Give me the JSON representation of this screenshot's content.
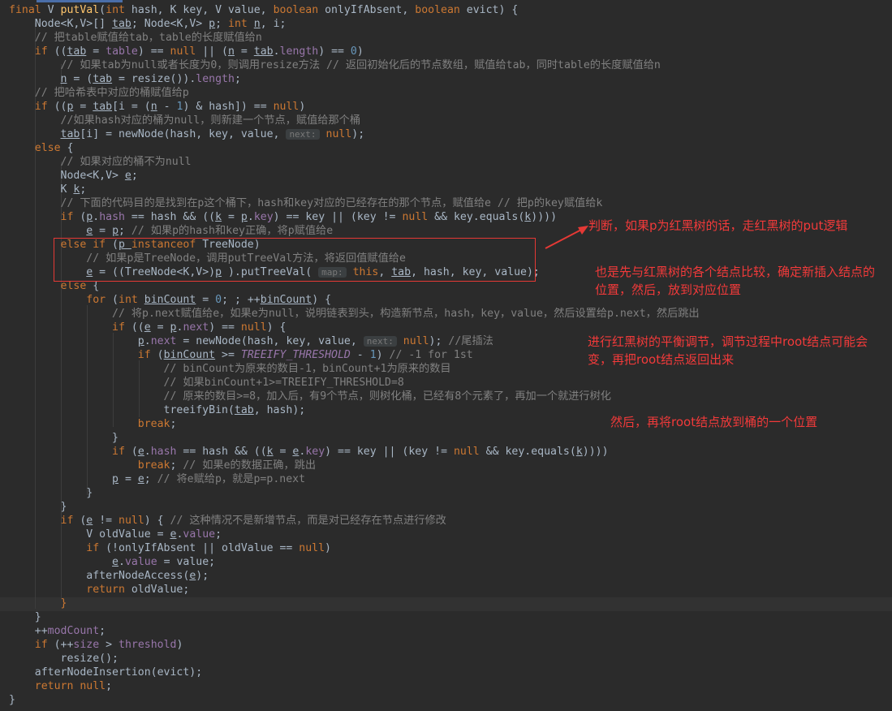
{
  "annotations": {
    "a1": "判断，如果p为红黑树的话，走红黑树的put逻辑",
    "a2": "也是先与红黑树的各个结点比较，确定新插入结点的位置，然后，放到对应位置",
    "a3": "进行红黑树的平衡调节，调节过程中root结点可能会变，再把root结点返回出来",
    "a4": "然后，再将root结点放到桶的一个位置"
  },
  "code": [
    [
      [
        "kw",
        "final "
      ],
      [
        "",
        "V "
      ],
      [
        "m",
        "putVal"
      ],
      [
        "",
        "("
      ],
      [
        "kw",
        "int "
      ],
      [
        "",
        "hash, K key, V value, "
      ],
      [
        "kw",
        "boolean "
      ],
      [
        "",
        "onlyIfAbsent, "
      ],
      [
        "kw",
        "boolean "
      ],
      [
        "",
        "evict) {"
      ]
    ],
    [
      [
        "",
        "    Node<K,V>[] "
      ],
      [
        "ul",
        "tab"
      ],
      [
        "",
        "; Node<K,V> "
      ],
      [
        "ul",
        "p"
      ],
      [
        "",
        "; "
      ],
      [
        "kw",
        "int "
      ],
      [
        "ul",
        "n"
      ],
      [
        "",
        ", i;"
      ]
    ],
    [
      [
        "c",
        "    // 把table赋值给tab，table的长度赋值给n"
      ]
    ],
    [
      [
        "kw",
        "    if "
      ],
      [
        "",
        "(("
      ],
      [
        "ul",
        "tab"
      ],
      [
        "",
        " = "
      ],
      [
        "f",
        "table"
      ],
      [
        "",
        ") == "
      ],
      [
        "kw",
        "null "
      ],
      [
        "",
        "|| ("
      ],
      [
        "ul",
        "n"
      ],
      [
        "",
        " = "
      ],
      [
        "ul",
        "tab"
      ],
      [
        "",
        "."
      ],
      [
        "f",
        "length"
      ],
      [
        "",
        ") == "
      ],
      [
        "num",
        "0"
      ],
      [
        "",
        ")"
      ]
    ],
    [
      [
        "c",
        "        // 如果tab为null或者长度为0，则调用resize方法 // 返回初始化后的节点数组，赋值给tab，同时table的长度赋值给n"
      ]
    ],
    [
      [
        "",
        "        "
      ],
      [
        "ul",
        "n"
      ],
      [
        "",
        " = ("
      ],
      [
        "ul",
        "tab"
      ],
      [
        "",
        " = resize())."
      ],
      [
        "f",
        "length"
      ],
      [
        "",
        ";"
      ]
    ],
    [
      [
        "c",
        "    // 把哈希表中对应的桶赋值给p"
      ]
    ],
    [
      [
        "kw",
        "    if "
      ],
      [
        "",
        "(("
      ],
      [
        "ul",
        "p"
      ],
      [
        "",
        " = "
      ],
      [
        "ul",
        "tab"
      ],
      [
        "",
        "[i = ("
      ],
      [
        "ul",
        "n"
      ],
      [
        "",
        " - "
      ],
      [
        "num",
        "1"
      ],
      [
        "",
        ") & hash]) == "
      ],
      [
        "kw",
        "null"
      ],
      [
        "",
        ")"
      ]
    ],
    [
      [
        "c",
        "        //如果hash对应的桶为null，则新建一个节点，赋值给那个桶"
      ]
    ],
    [
      [
        "",
        "        "
      ],
      [
        "ul",
        "tab"
      ],
      [
        "",
        "[i] = newNode(hash, key, value, "
      ],
      [
        "hint",
        "next:"
      ],
      [
        "kw",
        " null"
      ],
      [
        "",
        ");"
      ]
    ],
    [
      [
        "kw",
        "    else "
      ],
      [
        "",
        "{"
      ]
    ],
    [
      [
        "c",
        "        // 如果对应的桶不为null"
      ]
    ],
    [
      [
        "",
        "        Node<K,V> "
      ],
      [
        "ul",
        "e"
      ],
      [
        "",
        ";"
      ]
    ],
    [
      [
        "",
        "        K "
      ],
      [
        "ul",
        "k"
      ],
      [
        "",
        ";"
      ]
    ],
    [
      [
        "c",
        "        // 下面的代码目的是找到在p这个桶下，hash和key对应的已经存在的那个节点，赋值给e // 把p的key赋值给k"
      ]
    ],
    [
      [
        "kw",
        "        if "
      ],
      [
        "",
        "("
      ],
      [
        "ul",
        "p"
      ],
      [
        "",
        "."
      ],
      [
        "f",
        "hash"
      ],
      [
        "",
        " == hash && (("
      ],
      [
        "ul",
        "k"
      ],
      [
        "",
        " = "
      ],
      [
        "ul",
        "p"
      ],
      [
        "",
        "."
      ],
      [
        "f",
        "key"
      ],
      [
        "",
        ") == key || (key != "
      ],
      [
        "kw",
        "null "
      ],
      [
        "",
        "&& key.equals("
      ],
      [
        "ul",
        "k"
      ],
      [
        "",
        "))))"
      ]
    ],
    [
      [
        "",
        "            "
      ],
      [
        "ul",
        "e"
      ],
      [
        "",
        " = "
      ],
      [
        "ul",
        "p"
      ],
      [
        "",
        "; "
      ],
      [
        "c",
        "// 如果p的hash和key正确，将p赋值给e"
      ]
    ],
    [
      [
        "kw",
        "        else if "
      ],
      [
        "",
        "("
      ],
      [
        "ul",
        "p "
      ],
      [
        "kw",
        "instanceof "
      ],
      [
        "",
        "TreeNode)"
      ]
    ],
    [
      [
        "c",
        "            // 如果p是TreeNode，调用putTreeVal方法，将返回值赋值给e"
      ]
    ],
    [
      [
        "",
        "            "
      ],
      [
        "ul",
        "e"
      ],
      [
        "",
        " = ((TreeNode<K,V>)"
      ],
      [
        "ul",
        "p"
      ],
      [
        "",
        " ).putTreeVal( "
      ],
      [
        "hint",
        "map:"
      ],
      [
        "kw",
        " this"
      ],
      [
        "",
        ", "
      ],
      [
        "ul",
        "tab"
      ],
      [
        "",
        ", hash, key, value);"
      ]
    ],
    [
      [
        "kw",
        "        else "
      ],
      [
        "",
        "{"
      ]
    ],
    [
      [
        "kw",
        "            for "
      ],
      [
        "",
        "("
      ],
      [
        "kw",
        "int "
      ],
      [
        "ul",
        "binCount"
      ],
      [
        "",
        " = "
      ],
      [
        "num",
        "0"
      ],
      [
        "",
        "; ; ++"
      ],
      [
        "ul",
        "binCount"
      ],
      [
        "",
        ") {"
      ]
    ],
    [
      [
        "c",
        "                // 将p.next赋值给e，如果e为null，说明链表到头，构造新节点，hash，key，value，然后设置给p.next，然后跳出"
      ]
    ],
    [
      [
        "kw",
        "                if "
      ],
      [
        "",
        "(("
      ],
      [
        "ul",
        "e"
      ],
      [
        "",
        " = "
      ],
      [
        "ul",
        "p"
      ],
      [
        "",
        "."
      ],
      [
        "f",
        "next"
      ],
      [
        "",
        ") == "
      ],
      [
        "kw",
        "null"
      ],
      [
        "",
        ") {"
      ]
    ],
    [
      [
        "",
        "                    "
      ],
      [
        "ul",
        "p"
      ],
      [
        "",
        "."
      ],
      [
        "f",
        "next"
      ],
      [
        "",
        " = newNode(hash, key, value, "
      ],
      [
        "hint",
        "next:"
      ],
      [
        "kw",
        " null"
      ],
      [
        "",
        "); "
      ],
      [
        "c",
        "//尾插法"
      ]
    ],
    [
      [
        "kw",
        "                    if "
      ],
      [
        "",
        "("
      ],
      [
        "ul",
        "binCount"
      ],
      [
        "",
        " >= "
      ],
      [
        "f it",
        "TREEIFY_THRESHOLD"
      ],
      [
        "",
        " - "
      ],
      [
        "num",
        "1"
      ],
      [
        "",
        ") "
      ],
      [
        "c",
        "// -1 for 1st"
      ]
    ],
    [
      [
        "c",
        "                        // binCount为原来的数目-1，binCount+1为原来的数目"
      ]
    ],
    [
      [
        "c",
        "                        // 如果binCount+1>=TREEIFY_THRESHOLD=8"
      ]
    ],
    [
      [
        "c",
        "                        // 原来的数目>=8，加入后，有9个节点，则树化桶，已经有8个元素了，再加一个就进行树化"
      ]
    ],
    [
      [
        "",
        "                        treeifyBin("
      ],
      [
        "ul",
        "tab"
      ],
      [
        "",
        ", hash);"
      ]
    ],
    [
      [
        "kw",
        "                    break"
      ],
      [
        "",
        ";"
      ]
    ],
    [
      [
        "",
        "                }"
      ]
    ],
    [
      [
        "kw",
        "                if "
      ],
      [
        "",
        "("
      ],
      [
        "ul",
        "e"
      ],
      [
        "",
        "."
      ],
      [
        "f",
        "hash"
      ],
      [
        "",
        " == hash && (("
      ],
      [
        "ul",
        "k"
      ],
      [
        "",
        " = "
      ],
      [
        "ul",
        "e"
      ],
      [
        "",
        "."
      ],
      [
        "f",
        "key"
      ],
      [
        "",
        ") == key || (key != "
      ],
      [
        "kw",
        "null "
      ],
      [
        "",
        "&& key.equals("
      ],
      [
        "ul",
        "k"
      ],
      [
        "",
        "))))"
      ]
    ],
    [
      [
        "kw",
        "                    break"
      ],
      [
        "",
        "; "
      ],
      [
        "c",
        "// 如果e的数据正确，跳出"
      ]
    ],
    [
      [
        "",
        "                "
      ],
      [
        "ul",
        "p"
      ],
      [
        "",
        " = "
      ],
      [
        "ul",
        "e"
      ],
      [
        "",
        "; "
      ],
      [
        "c",
        "// 将e赋给p，就是p=p.next"
      ]
    ],
    [
      [
        "",
        "            }"
      ]
    ],
    [
      [
        "",
        "        }"
      ]
    ],
    [
      [
        "kw",
        "        if "
      ],
      [
        "",
        "("
      ],
      [
        "ul",
        "e"
      ],
      [
        "",
        " != "
      ],
      [
        "kw",
        "null"
      ],
      [
        "",
        ") { "
      ],
      [
        "c",
        "// 这种情况不是新增节点，而是对已经存在节点进行修改"
      ]
    ],
    [
      [
        "",
        "            V oldValue = "
      ],
      [
        "ul",
        "e"
      ],
      [
        "",
        "."
      ],
      [
        "f",
        "value"
      ],
      [
        "",
        ";"
      ]
    ],
    [
      [
        "kw",
        "            if "
      ],
      [
        "",
        "(!onlyIfAbsent || oldValue == "
      ],
      [
        "kw",
        "null"
      ],
      [
        "",
        ")"
      ]
    ],
    [
      [
        "",
        "                "
      ],
      [
        "ul",
        "e"
      ],
      [
        "",
        "."
      ],
      [
        "f",
        "value"
      ],
      [
        "",
        " = value;"
      ]
    ],
    [
      [
        "",
        "            afterNodeAccess("
      ],
      [
        "ul",
        "e"
      ],
      [
        "",
        ");"
      ]
    ],
    [
      [
        "kw",
        "            return "
      ],
      [
        "",
        "oldValue;"
      ]
    ],
    [
      [
        "kw",
        "        }"
      ]
    ],
    [
      [
        "",
        "    }"
      ]
    ],
    [
      [
        "",
        "    ++"
      ],
      [
        "f",
        "modCount"
      ],
      [
        "",
        ";"
      ]
    ],
    [
      [
        "kw",
        "    if "
      ],
      [
        "",
        "(++"
      ],
      [
        "f",
        "size"
      ],
      [
        "",
        " > "
      ],
      [
        "f",
        "threshold"
      ],
      [
        "",
        ")"
      ]
    ],
    [
      [
        "",
        "        resize();"
      ]
    ],
    [
      [
        "",
        "    afterNodeInsertion(evict);"
      ]
    ],
    [
      [
        "kw",
        "    return null"
      ],
      [
        "",
        ";"
      ]
    ],
    [
      [
        "",
        "}"
      ]
    ]
  ]
}
